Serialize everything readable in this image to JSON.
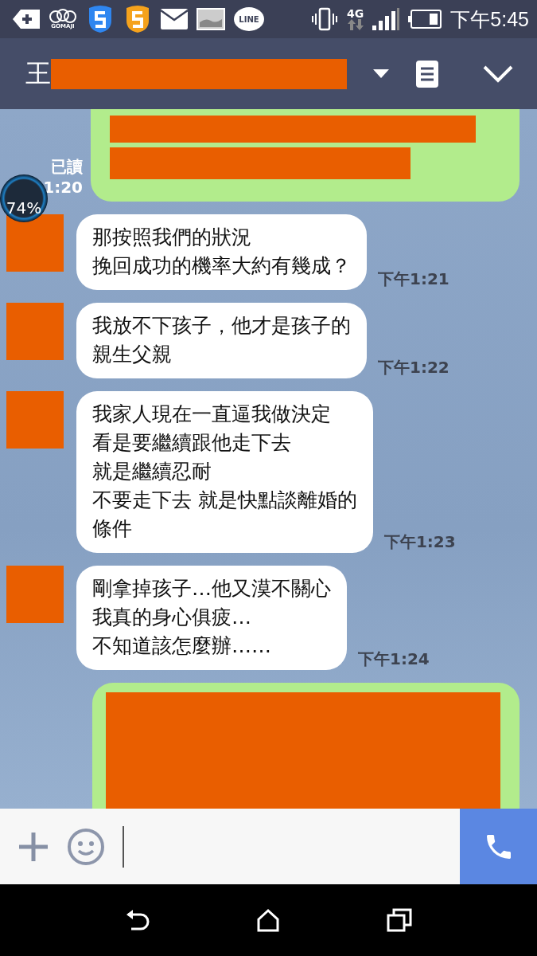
{
  "status_bar": {
    "notifications": [
      {
        "kind": "tag"
      },
      {
        "kind": "faces",
        "label": "GOMAJI"
      },
      {
        "kind": "shield",
        "color": "#2f86f0"
      },
      {
        "kind": "shield",
        "color": "#f5a21c"
      },
      {
        "kind": "mail"
      },
      {
        "kind": "image"
      },
      {
        "kind": "bubble",
        "label": "LINE"
      }
    ],
    "network": "4G",
    "time": "下午5:45"
  },
  "header": {
    "title": "王"
  },
  "messages": [
    {
      "kind": "sent",
      "read": "已讀",
      "time": "1:20"
    },
    {
      "kind": "received",
      "lines": [
        "那按照我們的狀況",
        "挽回成功的機率大約有幾成？"
      ],
      "time": "下午1:21"
    },
    {
      "kind": "received",
      "lines": [
        "我放不下孩子，他才是孩子的",
        "親生父親"
      ],
      "time": "下午1:22"
    },
    {
      "kind": "received",
      "lines": [
        "我家人現在一直逼我做決定",
        "看是要繼續跟他走下去",
        "就是繼續忍耐",
        "不要走下去 就是快點談離婚的",
        "條件"
      ],
      "time": "下午1:23"
    },
    {
      "kind": "received",
      "lines": [
        "剛拿掉孩子…他又漠不關心",
        "我真的身心俱疲…",
        "不知道該怎麼辦……"
      ],
      "time": "下午1:24"
    },
    {
      "kind": "sent_tall"
    }
  ],
  "battery_widget": {
    "text": "74%"
  }
}
